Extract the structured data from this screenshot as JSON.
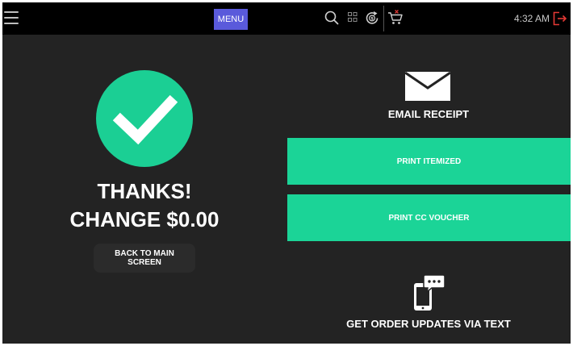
{
  "topbar": {
    "menu_label": "MENU",
    "time": "4:32 AM",
    "icons": [
      "hamburger-menu-icon",
      "search-icon",
      "grid-icon",
      "refund-icon",
      "cart-icon",
      "logout-icon"
    ],
    "accent_color": "#5a5adb",
    "logout_color": "#e53935"
  },
  "result": {
    "icon": "checkmark-icon",
    "title": "THANKS!",
    "change": "CHANGE $0.00",
    "back_label": "BACK TO MAIN SCREEN",
    "success_color": "#1bcf94"
  },
  "actions": {
    "email_icon": "envelope-icon",
    "email_label": "EMAIL RECEIPT",
    "print_itemized_label": "PRINT ITEMIZED",
    "print_cc_voucher_label": "PRINT CC VOUCHER",
    "text_icon": "phone-message-icon",
    "text_label": "GET ORDER UPDATES VIA TEXT",
    "button_color": "#1bd497"
  }
}
